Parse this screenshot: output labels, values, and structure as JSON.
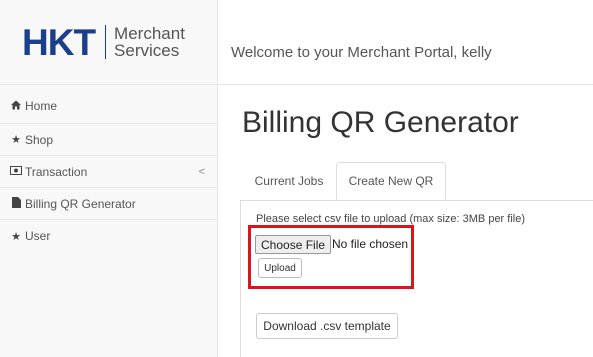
{
  "header": {
    "logo_main": "HKT",
    "logo_sub_line1": "Merchant",
    "logo_sub_line2": "Services",
    "welcome": "Welcome to your Merchant Portal, kelly"
  },
  "sidebar": {
    "items": [
      {
        "label": "Home",
        "icon": "home-icon"
      },
      {
        "label": "Shop",
        "icon": "star-icon"
      },
      {
        "label": "Transaction",
        "icon": "money-icon",
        "chevron": "<"
      },
      {
        "label": "Billing QR Generator",
        "icon": "file-icon"
      },
      {
        "label": "User",
        "icon": "star-icon"
      }
    ]
  },
  "main": {
    "title": "Billing QR Generator",
    "tabs": [
      {
        "label": "Current Jobs",
        "active": false
      },
      {
        "label": "Create New QR",
        "active": true
      }
    ],
    "upload_instruction": "Please select csv file to upload (max size: 3MB per file)",
    "choose_file_label": "Choose File",
    "no_file_text": "No file chosen",
    "upload_label": "Upload",
    "download_label": "Download .csv template"
  },
  "colors": {
    "brand": "#1c3f8c",
    "highlight": "#e0121b"
  }
}
